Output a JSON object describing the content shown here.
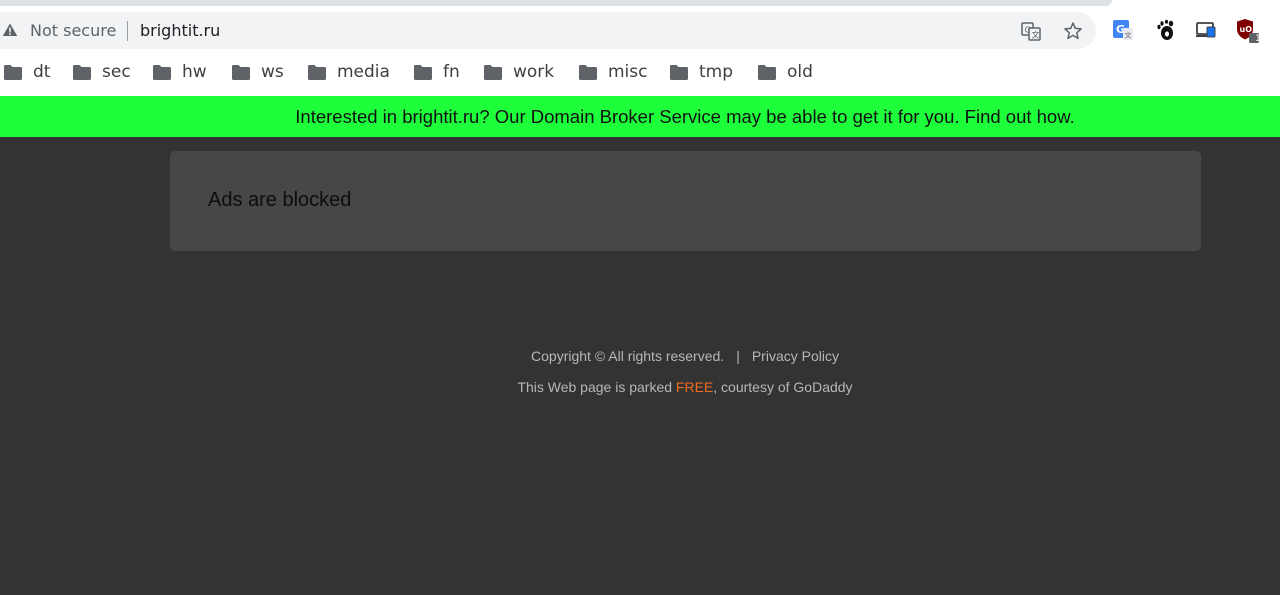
{
  "browser": {
    "security_label": "Not secure",
    "url": "brightit.ru",
    "icons": {
      "warning": "warning-triangle-icon",
      "translate": "translate-icon",
      "bookmark_star": "star-icon",
      "ext1": "google-translate-extension-icon",
      "ext2": "gnome-extension-icon",
      "ext3": "cast-screen-icon",
      "ext4": "ublock-origin-icon"
    },
    "ext4_badge": "1"
  },
  "bookmarks": [
    {
      "label": "dt"
    },
    {
      "label": "sec"
    },
    {
      "label": "hw"
    },
    {
      "label": "ws"
    },
    {
      "label": "media"
    },
    {
      "label": "fn"
    },
    {
      "label": "work"
    },
    {
      "label": "misc"
    },
    {
      "label": "tmp"
    },
    {
      "label": "old"
    }
  ],
  "banner": {
    "text": "Interested in brightit.ru? Our Domain Broker Service may be able to get it for you. Find out how.",
    "color": "#1eff3c"
  },
  "main": {
    "ads_message": "Ads are blocked"
  },
  "footer": {
    "copyright": "Copyright © All rights reserved.",
    "separator": "|",
    "privacy": "Privacy Policy",
    "parked_prefix": "This Web page is parked ",
    "free": "FREE",
    "parked_suffix": ", courtesy of GoDaddy",
    "free_color": "#f26b21"
  }
}
